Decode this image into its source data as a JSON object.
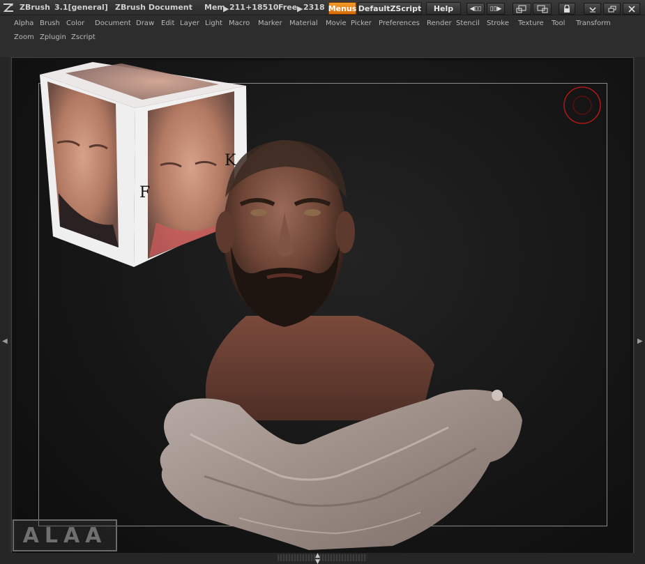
{
  "titlebar": {
    "app_name": "ZBrush",
    "version": "3.1[general]",
    "document": "ZBrush Document",
    "mem_label": "Mem",
    "mem_value": "211+18510",
    "free_label": "Free",
    "free_value": "2318",
    "menus_button": "Menus",
    "script_button": "DefaultZScript",
    "help_button": "Help"
  },
  "menu_row1": [
    "Alpha",
    "Brush",
    "Color",
    "Document",
    "Draw",
    "Edit",
    "Layer",
    "Light",
    "Macro",
    "Marker",
    "Material",
    "Movie",
    "Picker",
    "Preferences",
    "Render",
    "Stencil",
    "Stroke",
    "Texture",
    "Tool",
    "Transform"
  ],
  "menu_row2": [
    "Zoom",
    "Zplugin",
    "Zscript"
  ],
  "cube_text": [
    "K",
    "F"
  ],
  "watermark": "ALAA",
  "colors": {
    "accent": "#e8820f",
    "gizmo": "#b21818",
    "canvas_bg": "#141414",
    "skin": "#7a5040",
    "cloth": "#a99a92"
  },
  "icons": {
    "app_logo": "zbrush-logo-icon",
    "gizmo": "rotation-gizmo-icon",
    "lock": "lock-icon",
    "minimize": "minimize-icon",
    "restore": "restore-icon",
    "close": "close-icon"
  }
}
